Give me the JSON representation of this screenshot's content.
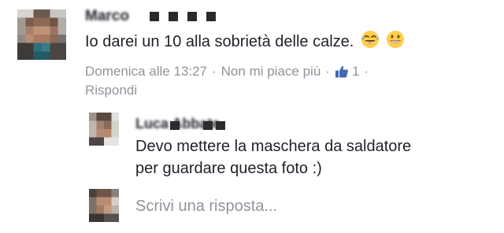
{
  "comment": {
    "author_name": "Marco",
    "text": "Io darei un 10 alla sobrietà delle calze.",
    "emojis": [
      "tears-of-joy",
      "grinning-face"
    ],
    "timestamp": "Domenica alle 13:27",
    "separator": "·",
    "like_toggle": "Non mi piace più",
    "like_count": "1",
    "reply_link": "Rispondi"
  },
  "reply": {
    "author_name": "Luca Abbate",
    "text_line1": "Devo mettere la maschera da saldatore",
    "text_line2": "per guardare questa foto :)"
  },
  "composer": {
    "placeholder": "Scrivi una risposta..."
  },
  "colors": {
    "text": "#1d2129",
    "meta": "#90949c",
    "like_blue": "#4267b2",
    "emoji_yellow": "#ffcc4d"
  }
}
